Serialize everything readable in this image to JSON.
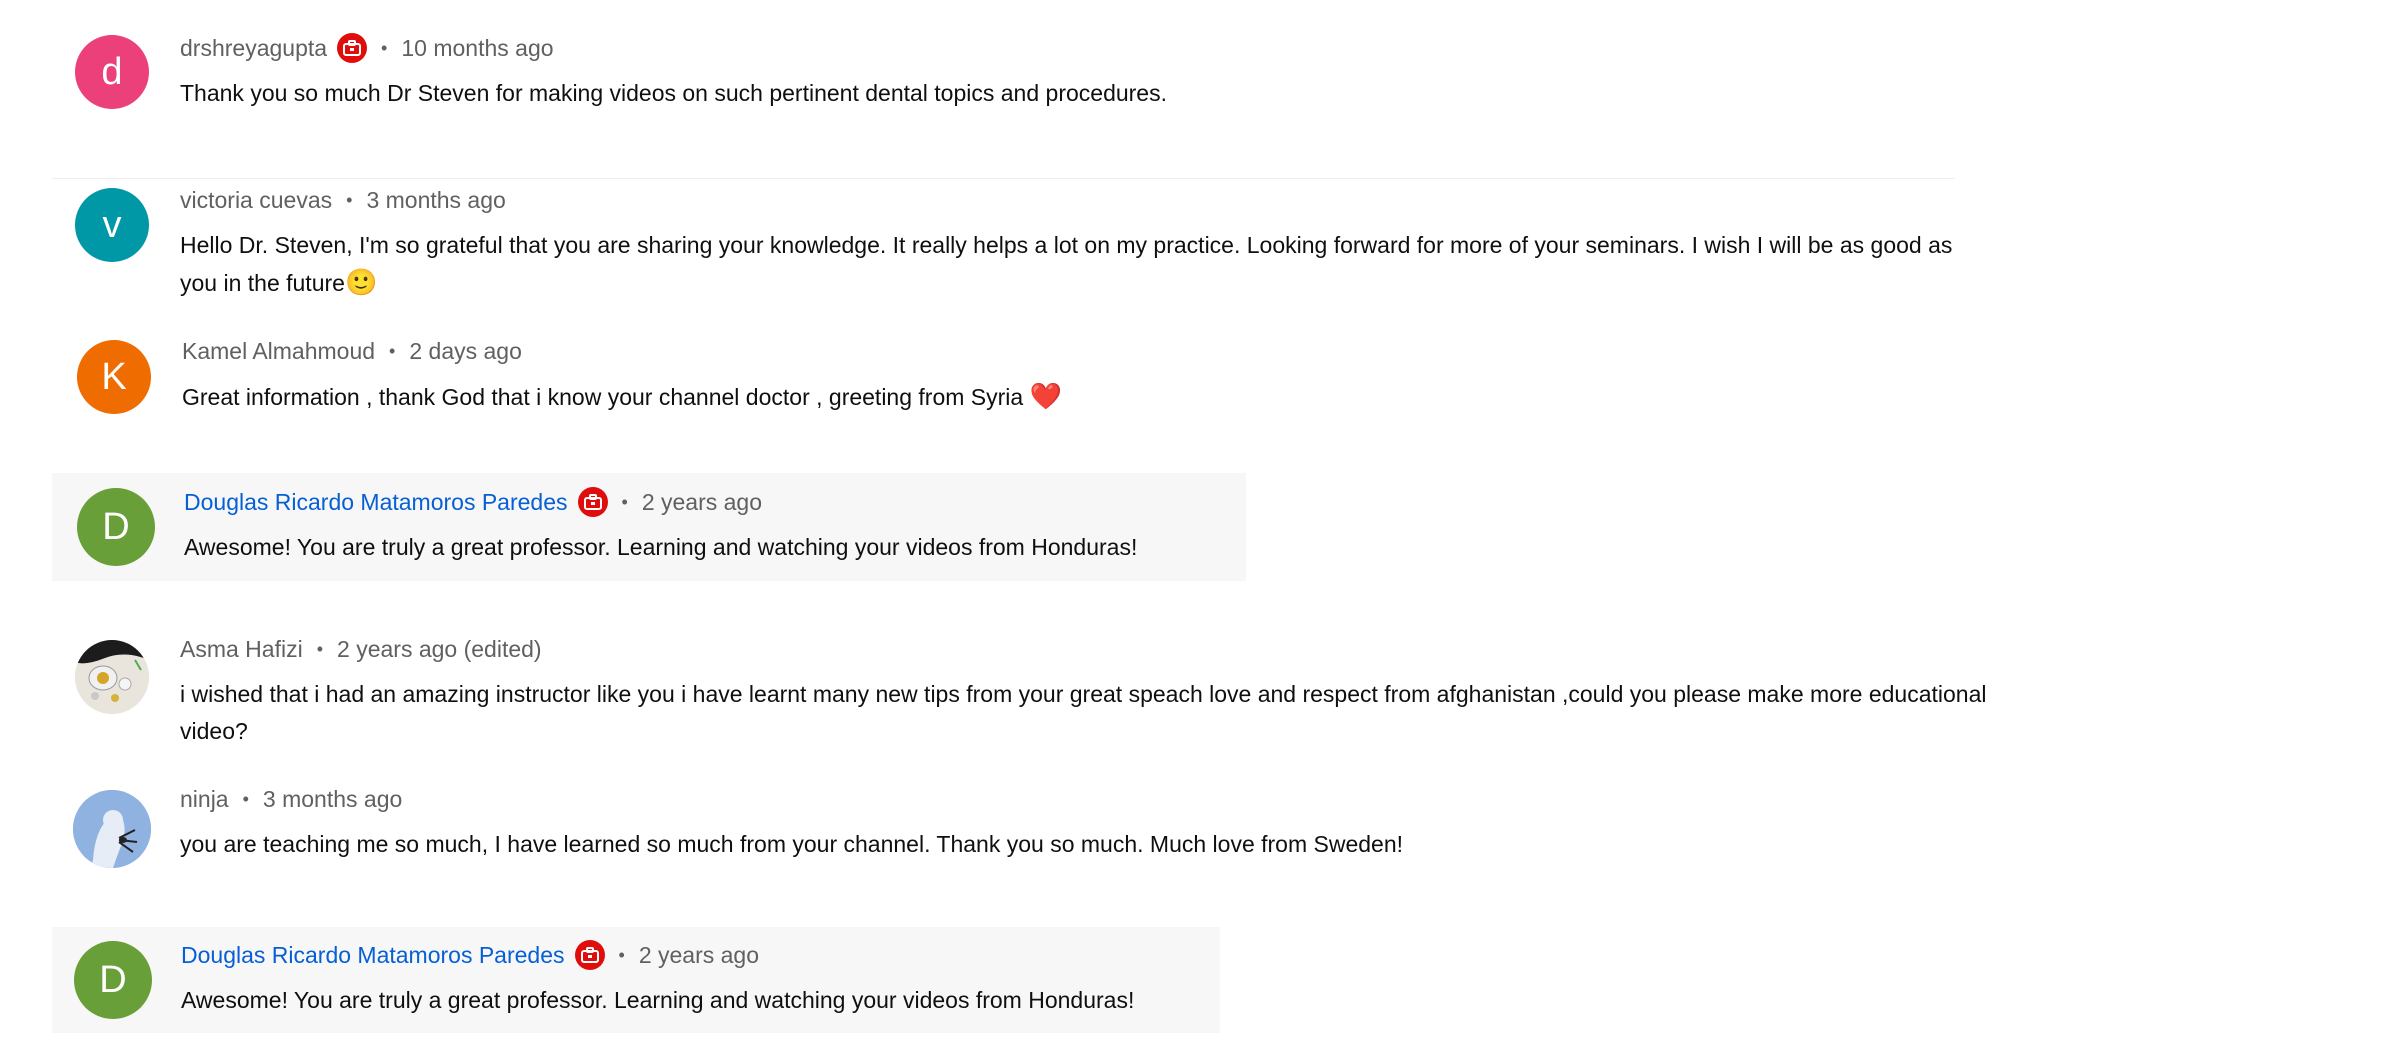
{
  "accent": {
    "creator_link": "#065fd4",
    "badge_red": "#e00d0d",
    "meta_gray": "#606060"
  },
  "comments": [
    {
      "avatar_letter": "d",
      "avatar_color": "#ec407a",
      "author": "drshreyagupta",
      "has_badge": true,
      "separator": "•",
      "time": "10 months ago",
      "text": "Thank you so much Dr Steven for making videos on such pertinent dental topics and procedures."
    },
    {
      "avatar_letter": "v",
      "avatar_color": "#0097a7",
      "author": "victoria cuevas",
      "has_badge": false,
      "separator": "•",
      "time": "3 months ago",
      "text": "Hello Dr. Steven, I'm so grateful that you are sharing your knowledge. It really helps a lot on my practice. Looking forward for more of your seminars. I wish I will be as good as you in the future",
      "emoji": "🙂"
    },
    {
      "avatar_letter": "K",
      "avatar_color": "#ef6c00",
      "author": "Kamel Almahmoud",
      "has_badge": false,
      "separator": "•",
      "time": "2 days ago",
      "text": "Great information , thank God that i know your channel doctor , greeting from Syria ",
      "emoji": "❤️"
    },
    {
      "avatar_letter": "D",
      "avatar_color": "#689f38",
      "author": "Douglas Ricardo Matamoros Paredes",
      "has_badge": true,
      "separator": "•",
      "time": "2 years ago",
      "text": "Awesome! You are truly a great professor. Learning and watching your videos from Honduras!"
    },
    {
      "avatar_image": "photo-avatar",
      "author": "Asma Hafizi",
      "has_badge": false,
      "separator": "•",
      "time": "2 years ago (edited)",
      "text": "i wished that i had an amazing instructor like you i have learnt many new tips from your great speach love and respect from afghanistan ,could you please make more educational video?"
    },
    {
      "avatar_image": "illustration-avatar",
      "author": "ninja",
      "has_badge": false,
      "separator": "•",
      "time": "3 months ago",
      "text": "you are teaching me so much, I have learned so much from your channel. Thank you so much. Much love from Sweden!"
    },
    {
      "avatar_letter": "D",
      "avatar_color": "#689f38",
      "author": "Douglas Ricardo Matamoros Paredes",
      "has_badge": true,
      "separator": "•",
      "time": "2 years ago",
      "text": "Awesome! You are truly a great professor. Learning and watching your videos from Honduras!"
    }
  ]
}
